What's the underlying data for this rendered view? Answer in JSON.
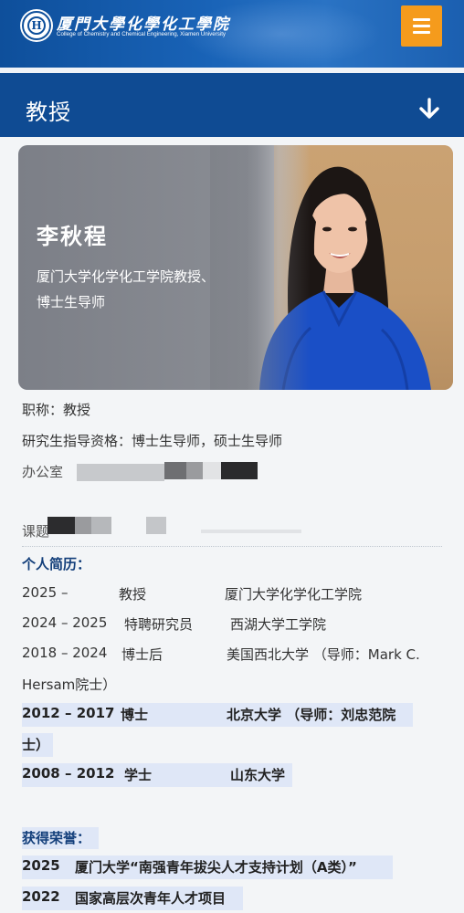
{
  "header": {
    "logo_mark": "H",
    "logo_cn": "厦門大學化學化工學院",
    "logo_en": "College of Chemistry and Chemical Engineering, Xiamen University",
    "menu_icon": "hamburger-icon",
    "accent_color": "#f59b1c",
    "brand_color": "#0f4b93"
  },
  "section": {
    "title": "教授",
    "toggle_icon": "arrow-down-icon"
  },
  "profile": {
    "name": "李秋程",
    "description": "厦门大学化学化工学院教授、博士生导师"
  },
  "info": {
    "title_line": "职称：教授",
    "advisor_line": "研究生指导资格：博士生导师，硕士生导师",
    "office_fragment": "办公室",
    "topic_fragment": "课题"
  },
  "resume": {
    "heading": "个人简历：",
    "rows": [
      {
        "years": "2025 –",
        "role": "教授",
        "place": "厦门大学化学化工学院"
      },
      {
        "years": "2024 – 2025",
        "role": "特聘研究员",
        "place": "西湖大学工学院"
      },
      {
        "years": "2018 – 2024",
        "role": "博士后",
        "place": "美国西北大学 （导师：Mark C.",
        "place_cont": "Hersam院士）"
      },
      {
        "years": "2012 – 2017",
        "role": "博士",
        "place": "北京大学 （导师：刘忠范院",
        "place_cont": "士）"
      },
      {
        "years": "2008 – 2012",
        "role": "学士",
        "place": "山东大学"
      }
    ]
  },
  "honors": {
    "heading": "获得荣誉：",
    "rows": [
      {
        "year": "2025",
        "text": "厦门大学“南强青年拔尖人才支持计划（A类）”"
      },
      {
        "year": "2022",
        "text": "国家高层次青年人才项目"
      }
    ]
  }
}
